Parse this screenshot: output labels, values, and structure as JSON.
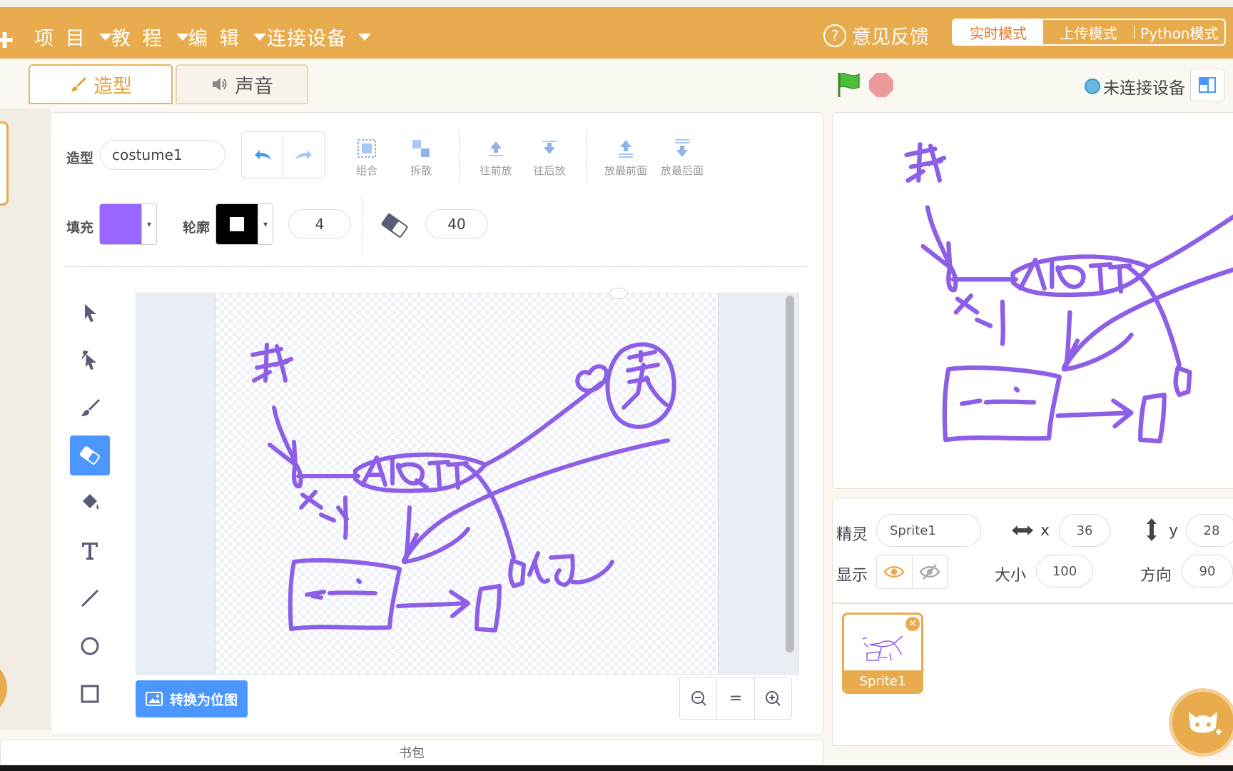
{
  "menubar": {
    "items": [
      {
        "label": "项 目"
      },
      {
        "label": "教 程"
      },
      {
        "label": "编 辑"
      },
      {
        "label": "连接设备"
      }
    ],
    "feedback_label": "意见反馈",
    "modes": [
      {
        "label": "实时模式",
        "active": true
      },
      {
        "label": "上传模式",
        "active": false
      },
      {
        "label": "Python模式",
        "active": false
      }
    ]
  },
  "tabs": [
    {
      "label": "造型",
      "active": true
    },
    {
      "label": "声音",
      "active": false
    }
  ],
  "editor": {
    "costume_label": "造型",
    "costume_name": "costume1",
    "undo_icon": "undo-icon",
    "redo_icon": "redo-icon",
    "toolbar": [
      {
        "label": "组合",
        "icon": "group-icon"
      },
      {
        "label": "拆散",
        "icon": "ungroup-icon"
      },
      {
        "label": "往前放",
        "icon": "forward-icon"
      },
      {
        "label": "往后放",
        "icon": "backward-icon"
      },
      {
        "label": "放最前面",
        "icon": "front-icon"
      },
      {
        "label": "放最后面",
        "icon": "back-icon"
      }
    ],
    "fill_label": "填充",
    "fill_color": "#9966ff",
    "outline_label": "轮廓",
    "outline_color": "#000000",
    "outline_width": "4",
    "eraser_size": "40",
    "tools": [
      "select-icon",
      "reshape-icon",
      "brush-icon",
      "eraser-icon",
      "fill-icon",
      "text-icon",
      "line-icon",
      "circle-icon",
      "rect-icon"
    ],
    "active_tool": "eraser-icon",
    "convert_label": "转换为位图",
    "zoom": {
      "out": "zoom-out-icon",
      "reset": "=",
      "in": "zoom-in-icon"
    }
  },
  "backpack_label": "书包",
  "stage": {
    "connection_status": "未连接设备",
    "stroke_color": "#8d5ee6"
  },
  "sprite_info": {
    "sprite_label": "精灵",
    "sprite_name": "Sprite1",
    "x_label": "x",
    "x_value": "36",
    "y_label": "y",
    "y_value": "28",
    "show_label": "显示",
    "size_label": "大小",
    "size_value": "100",
    "direction_label": "方向",
    "direction_value": "90"
  },
  "sprites": [
    {
      "name": "Sprite1",
      "selected": true
    }
  ]
}
